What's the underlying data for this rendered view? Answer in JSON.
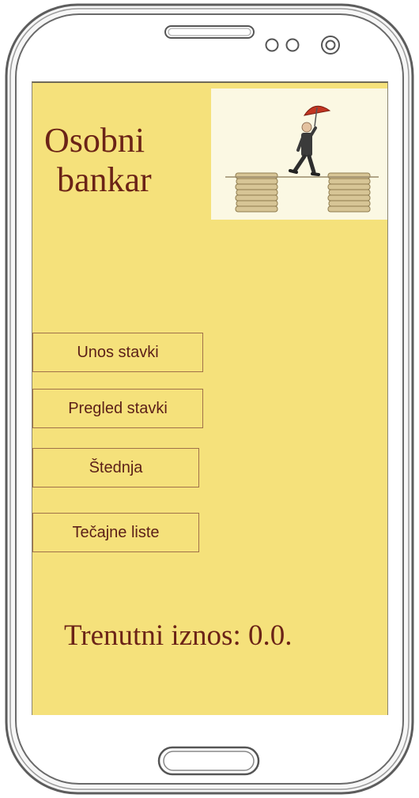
{
  "app": {
    "title_line1": "Osobni",
    "title_line2": "bankar"
  },
  "menu": {
    "items": [
      {
        "id": "unos-stavki",
        "label": "Unos stavki"
      },
      {
        "id": "pregled-stavki",
        "label": "Pregled stavki"
      },
      {
        "id": "stednja",
        "label": "Štednja"
      },
      {
        "id": "tecajne-liste",
        "label": "Tečajne liste"
      }
    ]
  },
  "balance": {
    "text": "Trenutni iznos: 0.0."
  },
  "colors": {
    "screen_background": "#f5e17b",
    "title_text": "#6b2317",
    "button_border": "#a0714a",
    "button_text": "#5b1f18"
  }
}
